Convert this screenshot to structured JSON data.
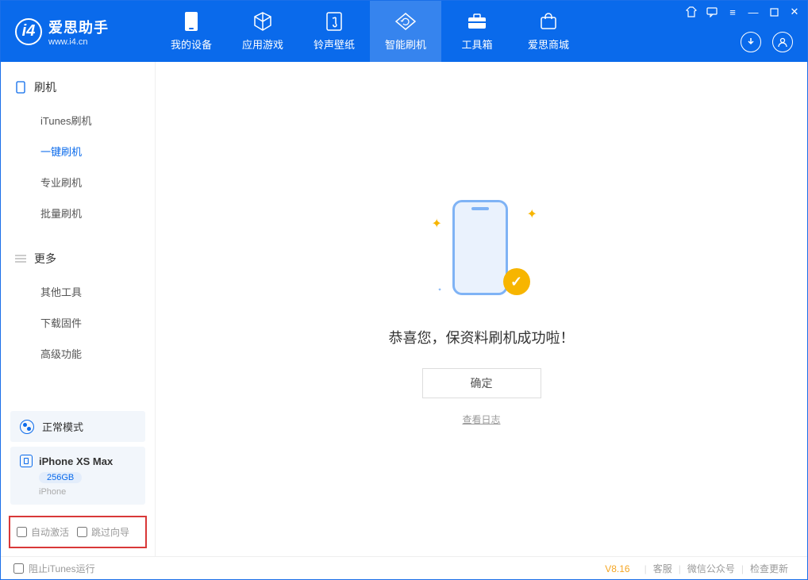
{
  "app": {
    "name": "爱思助手",
    "url": "www.i4.cn"
  },
  "nav": {
    "tabs": [
      {
        "label": "我的设备",
        "icon": "device-icon"
      },
      {
        "label": "应用游戏",
        "icon": "cube-icon"
      },
      {
        "label": "铃声壁纸",
        "icon": "music-icon"
      },
      {
        "label": "智能刷机",
        "icon": "refresh-icon",
        "active": true
      },
      {
        "label": "工具箱",
        "icon": "toolbox-icon"
      },
      {
        "label": "爱思商城",
        "icon": "store-icon"
      }
    ]
  },
  "sidebar": {
    "sections": [
      {
        "title": "刷机",
        "items": [
          {
            "label": "iTunes刷机"
          },
          {
            "label": "一键刷机",
            "active": true
          },
          {
            "label": "专业刷机"
          },
          {
            "label": "批量刷机"
          }
        ]
      },
      {
        "title": "更多",
        "items": [
          {
            "label": "其他工具"
          },
          {
            "label": "下载固件"
          },
          {
            "label": "高级功能"
          }
        ]
      }
    ],
    "mode": {
      "label": "正常模式"
    },
    "device": {
      "name": "iPhone XS Max",
      "storage": "256GB",
      "type": "iPhone"
    },
    "options": {
      "autoActivate": "自动激活",
      "skipGuide": "跳过向导"
    }
  },
  "main": {
    "message": "恭喜您，保资料刷机成功啦！",
    "okButton": "确定",
    "logLink": "查看日志"
  },
  "footer": {
    "blockItunes": "阻止iTunes运行",
    "version": "V8.16",
    "links": {
      "support": "客服",
      "wechat": "微信公众号",
      "update": "检查更新"
    }
  }
}
